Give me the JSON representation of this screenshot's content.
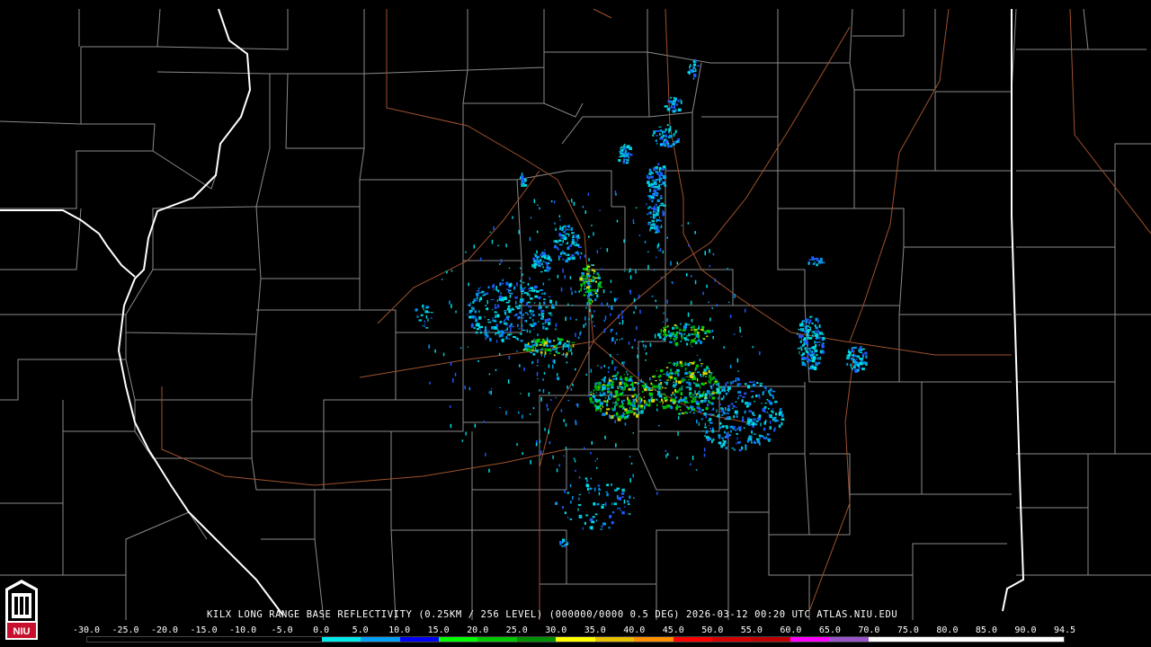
{
  "caption": "KILX LONG RANGE BASE REFLECTIVITY (0.25KM / 256 LEVEL) (000000/0000 0.5 DEG) 2026-03-12 00:20 UTC  ATLAS.NIU.EDU",
  "logo": {
    "text": "NIU",
    "colors": {
      "red": "#c8102e",
      "white": "#ffffff"
    }
  },
  "scale_labels": [
    "-30.0",
    "-25.0",
    "-20.0",
    "-15.0",
    "-10.0",
    "-5.0",
    "0.0",
    "5.0",
    "10.0",
    "15.0",
    "20.0",
    "25.0",
    "30.0",
    "35.0",
    "40.0",
    "45.0",
    "50.0",
    "55.0",
    "60.0",
    "65.0",
    "70.0",
    "75.0",
    "80.0",
    "85.0",
    "90.0",
    "94.5"
  ],
  "scale_colors": [
    "#000000",
    "#000000",
    "#000000",
    "#000000",
    "#000000",
    "#000000",
    "#00eaec",
    "#01a0f6",
    "#0000f6",
    "#00ff00",
    "#00c800",
    "#009000",
    "#ffff00",
    "#e7c000",
    "#ff9000",
    "#ff0000",
    "#d60000",
    "#c00000",
    "#ff00ff",
    "#9955c9",
    "#ffffff",
    "#ffffff",
    "#ffffff",
    "#ffffff",
    "#ffffff"
  ],
  "map_colors": {
    "county": "#8a8a8a",
    "state": "#ffffff",
    "highway": "#a0522d",
    "background": "#000000"
  }
}
